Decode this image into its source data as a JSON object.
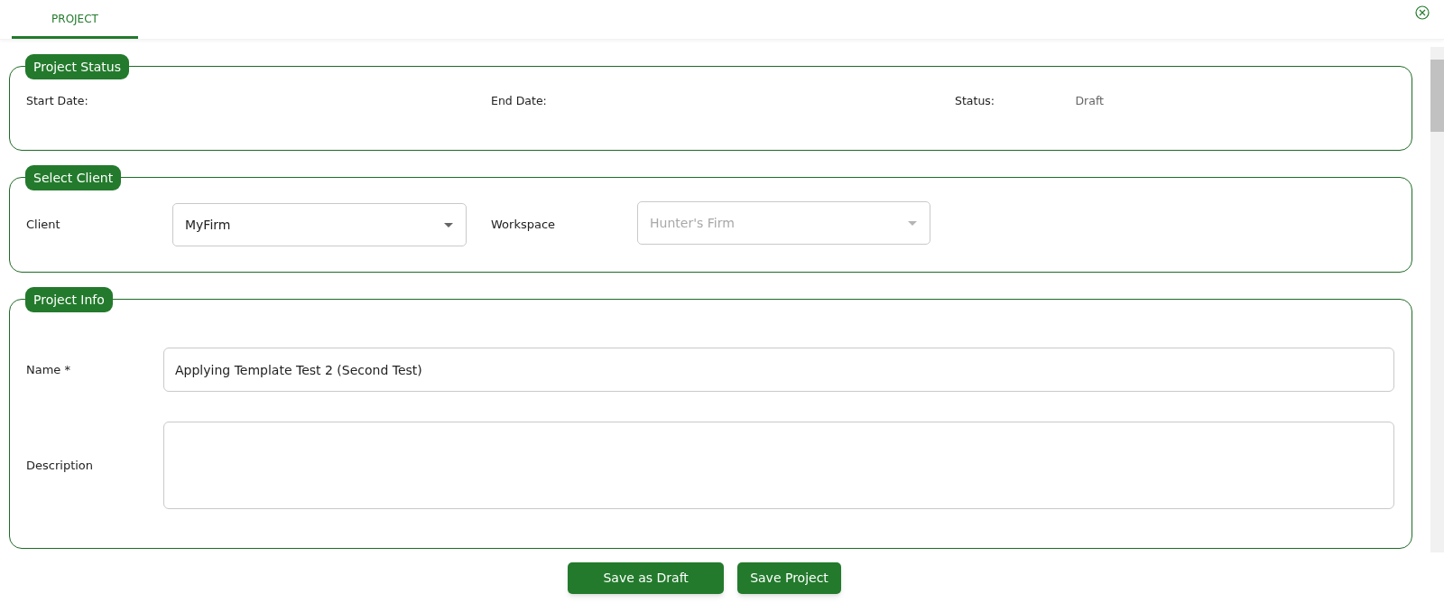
{
  "tabs": [
    {
      "label": "PROJECT",
      "selected": true
    }
  ],
  "project_status": {
    "legend": "Project Status",
    "fields": [
      {
        "label": "Start Date:"
      },
      {
        "label": "End Date:"
      },
      {
        "label": "Status:",
        "value": "Draft"
      }
    ]
  },
  "select_client": {
    "legend": "Select Client",
    "client": {
      "label": "Client",
      "value": "MyFirm",
      "disabled": false
    },
    "workspace": {
      "label": "Workspace",
      "value": "Hunter's Firm",
      "disabled": true
    }
  },
  "project_info": {
    "legend": "Project Info",
    "name": {
      "label": "Name *",
      "value": "Applying Template Test 2 (Second Test)"
    },
    "description": {
      "label": "Description"
    }
  },
  "buttons": [
    "Save as Draft",
    "Save Project"
  ]
}
